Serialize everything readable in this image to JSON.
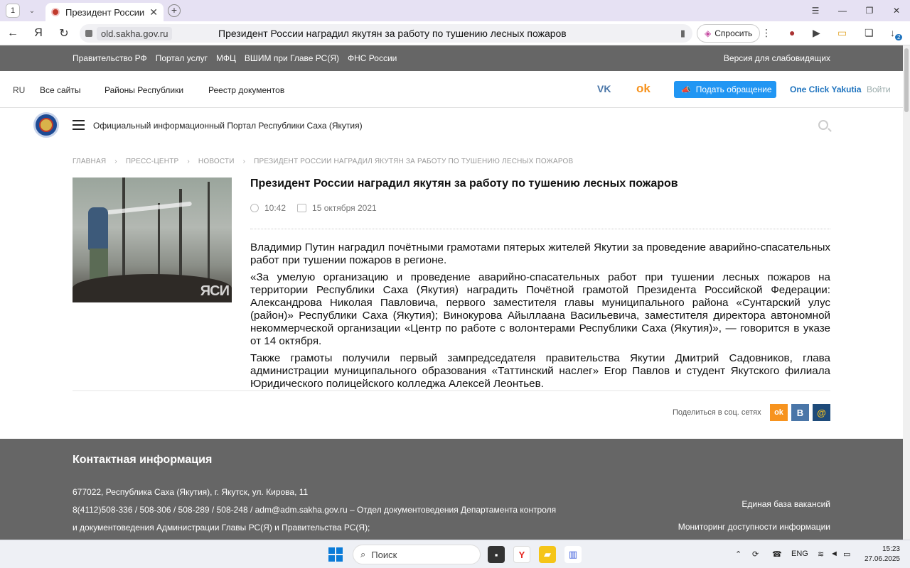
{
  "browser": {
    "tab_count": "1",
    "tab_title": "Президент России нагр",
    "domain": "old.sakha.gov.ru",
    "page_title": "Президент России наградил якутян за работу по тушению лесных пожаров",
    "ask_label": "Спросить",
    "download_badge": "2"
  },
  "govbar": {
    "links": [
      "Правительство РФ",
      "Портал услуг",
      "МФЦ",
      "ВШИМ при Главе РС(Я)",
      "ФНС России"
    ],
    "vision": "Версия для слабовидящих"
  },
  "nav": {
    "lang": "RU",
    "items": [
      "Все сайты",
      "Районы Республики",
      "Реестр документов"
    ],
    "appeal": "Подать обращение",
    "oneclick": "One Click Yakutia",
    "login": "Войти"
  },
  "portal": {
    "name": "Официальный информационный Портал Республики Саха (Якутия)"
  },
  "breadcrumbs": [
    "ГЛАВНАЯ",
    "ПРЕСС-ЦЕНТР",
    "НОВОСТИ",
    "ПРЕЗИДЕНТ РОССИИ НАГРАДИЛ ЯКУТЯН ЗА РАБОТУ ПО ТУШЕНИЮ ЛЕСНЫХ ПОЖАРОВ"
  ],
  "article": {
    "title": "Президент России наградил якутян за работу по тушению лесных пожаров",
    "time": "10:42",
    "date": "15 октября 2021",
    "photo_logo": "ЯСИ",
    "paragraphs": [
      "Владимир Путин наградил почётными грамотами пятерых жителей Якутии за проведение аварийно-спасательных работ при тушении пожаров в регионе.",
      "«За умелую организацию и проведение аварийно-спасательных работ при тушении лесных пожаров на территории Республики Саха (Якутия) наградить Почётной грамотой Президента Российской Федерации: Александрова Николая Павловича, первого заместителя главы муниципального района «Сунтарский улус (район)» Республики Саха (Якутия); Винокурова Айыллаана Васильевича, заместителя директора автономной некоммерческой организации «Центр по работе с волонтерами Республики Саха (Якутия)», — говорится в указе от 14 октября.",
      "Также грамоты получили первый зампредседателя правительства Якутии Дмитрий Садовников, глава администрации муниципального образования «Таттинский наслег» Егор Павлов и студент Якутского филиала Юридического полицейского колледжа Алексей Леонтьев."
    ],
    "share_label": "Поделиться в соц. сетях",
    "share_buttons": [
      "ok",
      "B",
      "@"
    ]
  },
  "footer": {
    "title": "Контактная информация",
    "address": "677022, Республика Саха (Якутия), г. Якутск, ул. Кирова, 11",
    "phones": "8(4112)508-336 / 508-306 / 508-289 / 508-248 / adm@adm.sakha.gov.ru – Отдел документоведения Департамента контроля",
    "phones2": "и документоведения Администрации Главы РС(Я) и Правительства РС(Я);",
    "link1": "Единая база вакансий",
    "link2": "Мониторинг доступности информации"
  },
  "taskbar": {
    "search": "Поиск",
    "lang": "ENG",
    "time": "15:23",
    "date": "27.06.2025"
  },
  "colors": {
    "accent_blue": "#2196f3",
    "gov_gray": "#666666",
    "ok_orange": "#f7931e",
    "vk_blue": "#4a76a8"
  }
}
